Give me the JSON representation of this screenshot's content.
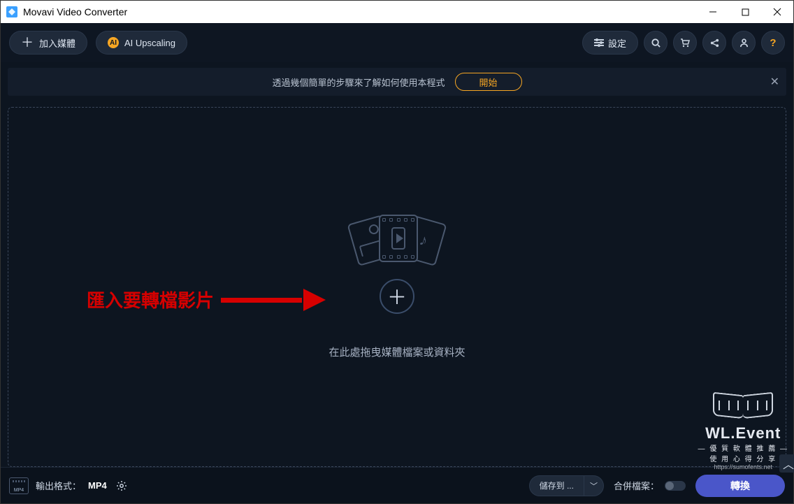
{
  "window": {
    "title": "Movavi Video Converter"
  },
  "toolbar": {
    "add_media": "加入媒體",
    "ai_upscaling": "AI Upscaling",
    "settings": "設定"
  },
  "tutorial": {
    "text": "透過幾個簡單的步驟來了解如何使用本程式",
    "start": "開始"
  },
  "dropzone": {
    "hint": "在此處拖曳媒體檔案或資料夾"
  },
  "annotation": {
    "text": "匯入要轉檔影片"
  },
  "watermark": {
    "title": "WL.Event",
    "sub1": "優 質 軟 體 推 薦",
    "sub2": "使 用 心 得 分 享",
    "url": "https://sumofents.net"
  },
  "bottom": {
    "output_label": "輸出格式：",
    "output_format": "MP4",
    "format_badge": "MP4",
    "save_to": "儲存到 ...",
    "merge_label": "合併檔案：",
    "convert": "轉換"
  }
}
